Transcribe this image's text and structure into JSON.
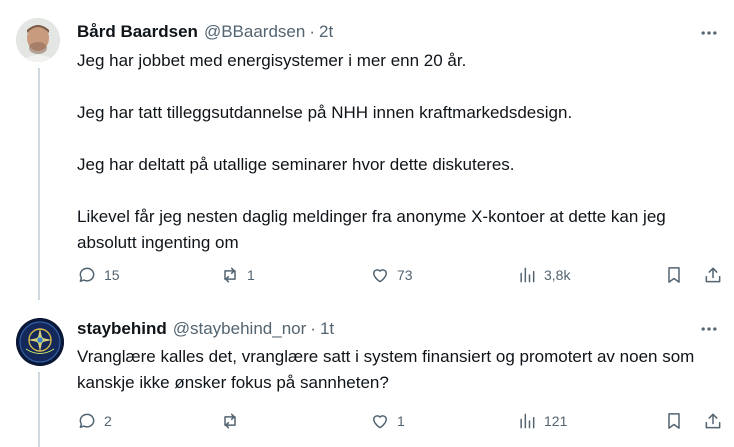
{
  "tweets": [
    {
      "author": "Bård Baardsen",
      "handle": "@BBaardsen",
      "separator": "·",
      "time": "2t",
      "paragraphs": [
        "Jeg har jobbet med energisystemer i mer enn 20 år.",
        "Jeg har tatt tilleggsutdannelse på NHH innen kraftmarkedsdesign.",
        "Jeg har deltatt på utallige seminarer hvor dette diskuteres.",
        "Likevel får jeg nesten daglig meldinger fra anonyme X-kontoer at dette kan jeg absolutt ingenting om"
      ],
      "replies": "15",
      "reposts": "1",
      "likes": "73",
      "views": "3,8k"
    },
    {
      "author": "staybehind",
      "handle": "@staybehind_nor",
      "separator": "·",
      "time": "1t",
      "avatar_text": "STAY BEHIND",
      "paragraphs": [
        "Vranglære kalles det, vranglære satt i system finansiert og promotert av noen som kanskje ikke ønsker fokus på sannheten?"
      ],
      "replies": "2",
      "reposts": "",
      "likes": "1",
      "views": "121"
    }
  ],
  "icons": {
    "more": "more-horizontal-icon",
    "reply": "reply-bubble-icon",
    "repost": "repost-arrows-icon",
    "like": "heart-icon",
    "views": "views-bars-icon",
    "bookmark": "bookmark-icon",
    "share": "share-upload-icon"
  },
  "colors": {
    "text_primary": "#0f1419",
    "text_secondary": "#536471",
    "thread_line": "#cfd9de"
  }
}
